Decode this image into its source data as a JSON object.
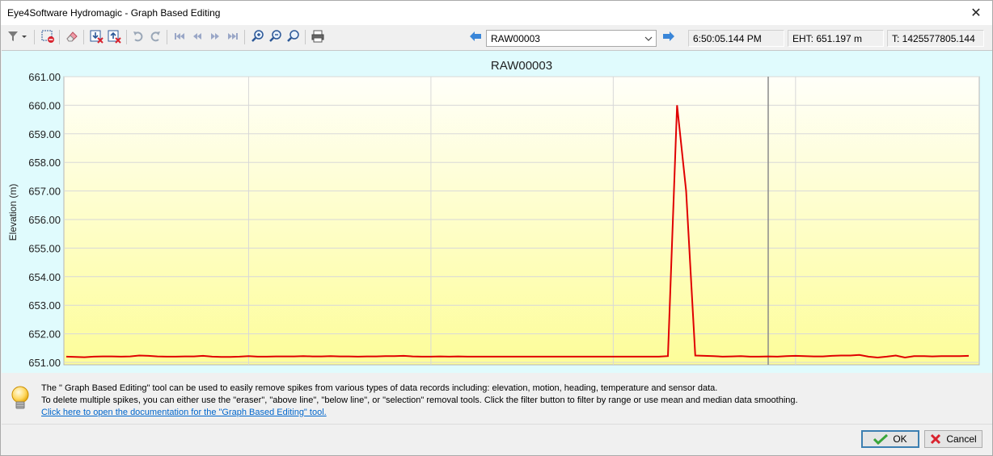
{
  "window": {
    "title": "Eye4Software Hydromagic - Graph Based Editing",
    "close_glyph": "✕"
  },
  "toolbar": {
    "buttons": [
      {
        "name": "filter-icon"
      },
      {
        "name": "delete-selection-icon"
      },
      {
        "name": "eraser-icon"
      },
      {
        "name": "delete-below-line-icon"
      },
      {
        "name": "delete-above-line-icon"
      },
      {
        "name": "undo-icon"
      },
      {
        "name": "redo-icon"
      },
      {
        "name": "first-record-icon"
      },
      {
        "name": "previous-record-icon"
      },
      {
        "name": "next-record-icon"
      },
      {
        "name": "last-record-icon"
      },
      {
        "name": "zoom-in-icon"
      },
      {
        "name": "zoom-out-icon"
      },
      {
        "name": "zoom-fit-icon"
      },
      {
        "name": "print-icon"
      }
    ],
    "record_selector": {
      "value": "RAW00003",
      "prev_icon": "arrow-left-icon",
      "next_icon": "arrow-right-icon"
    },
    "time_readout": "6:50:05.144 PM",
    "eht_readout": "EHT: 651.197 m",
    "t_readout": "T: 1425577805.144"
  },
  "chart_data": {
    "type": "line",
    "title": "RAW00003",
    "xlabel": "",
    "ylabel": "Elevation (m)",
    "ylim": [
      651.0,
      661.0
    ],
    "y_ticks": [
      "661.00",
      "660.00",
      "659.00",
      "658.00",
      "657.00",
      "656.00",
      "655.00",
      "654.00",
      "653.00",
      "652.00",
      "651.00"
    ],
    "grid": true,
    "series": [
      {
        "color": "#e00000",
        "x": [
          0,
          1,
          2,
          3,
          4,
          5,
          6,
          7,
          8,
          9,
          10,
          11,
          12,
          13,
          14,
          15,
          16,
          17,
          18,
          19,
          20,
          21,
          22,
          23,
          24,
          25,
          26,
          27,
          28,
          29,
          30,
          31,
          32,
          33,
          34,
          35,
          36,
          37,
          38,
          39,
          40,
          41,
          42,
          43,
          44,
          45,
          46,
          47,
          48,
          49,
          50,
          51,
          52,
          53,
          54,
          55,
          56,
          57,
          58,
          59,
          60,
          61,
          62,
          63,
          64,
          65,
          66,
          67,
          68,
          69,
          70,
          71,
          72,
          73,
          74,
          75,
          76,
          77,
          78,
          79,
          80,
          81,
          82,
          83,
          84,
          85,
          86,
          87,
          88,
          89,
          90,
          91,
          92,
          93,
          94,
          95,
          96,
          97,
          98,
          99
        ],
        "values": [
          651.2,
          651.19,
          651.18,
          651.2,
          651.21,
          651.21,
          651.2,
          651.21,
          651.24,
          651.23,
          651.21,
          651.2,
          651.2,
          651.21,
          651.21,
          651.23,
          651.2,
          651.19,
          651.19,
          651.2,
          651.22,
          651.2,
          651.2,
          651.21,
          651.21,
          651.21,
          651.22,
          651.21,
          651.21,
          651.22,
          651.21,
          651.21,
          651.2,
          651.21,
          651.21,
          651.22,
          651.22,
          651.23,
          651.21,
          651.2,
          651.2,
          651.21,
          651.2,
          651.21,
          651.2,
          651.2,
          651.2,
          651.2,
          651.2,
          651.2,
          651.2,
          651.2,
          651.2,
          651.2,
          651.2,
          651.2,
          651.2,
          651.2,
          651.2,
          651.2,
          651.2,
          651.2,
          651.2,
          651.2,
          651.2,
          651.2,
          651.22,
          660.0,
          657.0,
          651.24,
          651.23,
          651.22,
          651.2,
          651.21,
          651.22,
          651.2,
          651.2,
          651.21,
          651.2,
          651.22,
          651.23,
          651.22,
          651.21,
          651.21,
          651.23,
          651.24,
          651.24,
          651.26,
          651.2,
          651.17,
          651.2,
          651.24,
          651.17,
          651.22,
          651.22,
          651.21,
          651.22,
          651.22,
          651.22,
          651.23
        ]
      }
    ],
    "cursor_x": 77,
    "x_gridlines": [
      20,
      40,
      60,
      80
    ]
  },
  "info": {
    "line1": "The \" Graph Based Editing\" tool can be used to easily remove spikes from various types of data records including: elevation, motion, heading, temperature and sensor data.",
    "line2": "To delete multiple spikes, you can either use the \"eraser\", \"above line\", \"below line\", or \"selection\" removal tools. Click the filter button to filter by range or use mean and median data smoothing.",
    "link": "Click here to open the documentation for the \"Graph Based Editing\" tool."
  },
  "buttons": {
    "ok_label": "OK",
    "cancel_label": "Cancel"
  }
}
